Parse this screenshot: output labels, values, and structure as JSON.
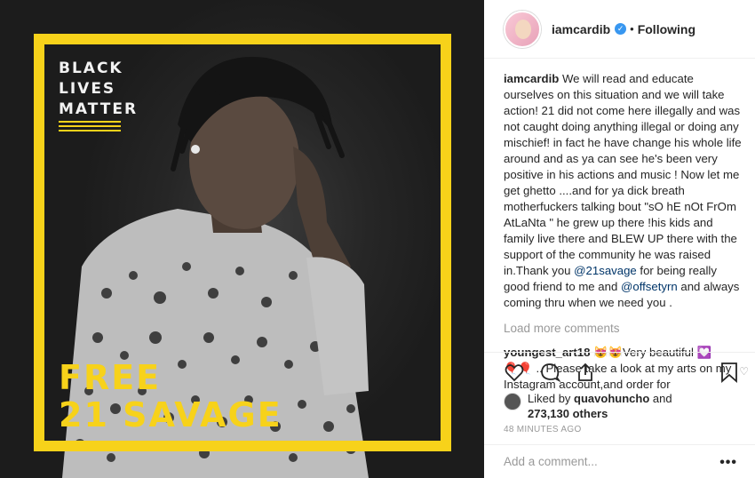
{
  "post_image": {
    "blm_lines": [
      "BLACK",
      "LIVES",
      "MATTER"
    ],
    "free_lines": [
      "FREE",
      "21 SAVAGE"
    ],
    "frame_color": "#f7d21a"
  },
  "header": {
    "username": "iamcardib",
    "verified_icon": "verified-badge-icon",
    "separator": "•",
    "follow_status": "Following"
  },
  "caption": {
    "username": "iamcardib",
    "text_before_mention1": " We will read and educate ourselves on this situation and we will take action! 21 did not come here illegally and was not caught doing anything illegal or doing any mischief! in fact he have change his whole life around and as ya can see he's been very positive in his actions and music ! Now let me get ghetto ....and for ya dick breath motherfuckers talking bout \"sO hE nOt FrOm AtLaNta \" he grew up there !his kids and family live there and BLEW UP there with the support of the community he was raised in.Thank you ",
    "mention1": "@21savage",
    "text_between": " for being really good friend to me and ",
    "mention2": "@offsetyrn",
    "text_after": " and always coming thru when we need you ."
  },
  "load_more": "Load more comments",
  "comment": {
    "username": "youngest_art18",
    "line1": " 😻😻Very beautiful 💟",
    "line2": "🎈🎈 .. Please take a look at my arts on my Instagram account,and order for"
  },
  "likes": {
    "prefix": "Liked by ",
    "liker": "quavohuncho",
    "conjunction": " and",
    "count_text": "273,130 others"
  },
  "timestamp": "48 MINUTES AGO",
  "add_comment_placeholder": "Add a comment...",
  "more_options": "•••"
}
